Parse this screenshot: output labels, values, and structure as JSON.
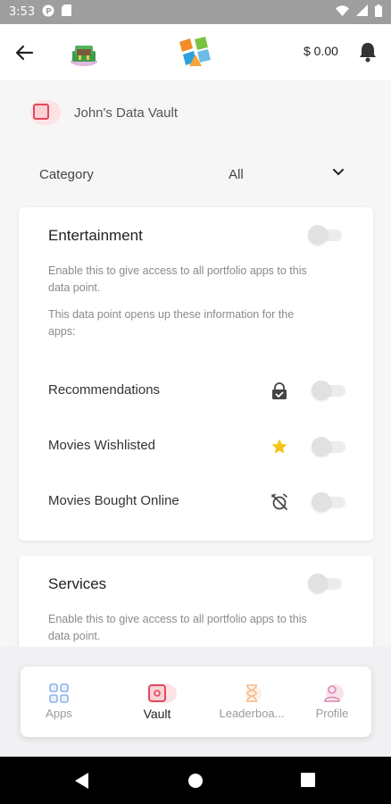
{
  "status_bar": {
    "time": "3:53"
  },
  "header": {
    "balance": "$ 0.00"
  },
  "vault": {
    "title": "John's Data Vault"
  },
  "category": {
    "label": "Category",
    "value": "All"
  },
  "entertainment": {
    "title": "Entertainment",
    "enable_desc": "Enable this to give access to all portfolio apps to this data point.",
    "opens_desc": "This data point opens up these information for the apps:",
    "items": [
      {
        "label": "Recommendations",
        "icon": "lock-check-icon"
      },
      {
        "label": "Movies Wishlisted",
        "icon": "star-icon"
      },
      {
        "label": "Movies Bought Online",
        "icon": "alarm-off-icon"
      }
    ]
  },
  "services": {
    "title": "Services",
    "enable_desc": "Enable this to give access to all portfolio apps to this data point."
  },
  "bottom_nav": [
    {
      "label": "Apps",
      "icon": "apps-grid-icon"
    },
    {
      "label": "Vault",
      "icon": "vault-icon"
    },
    {
      "label": "Leaderboa...",
      "icon": "hourglass-icon"
    },
    {
      "label": "Profile",
      "icon": "profile-icon"
    }
  ],
  "colors": {
    "accent_red": "#e3495a",
    "star_yellow": "#f5c518",
    "apps_blue": "#8fb1e8",
    "leader_orange": "#f7b98b",
    "profile_pink": "#d98ab0"
  }
}
